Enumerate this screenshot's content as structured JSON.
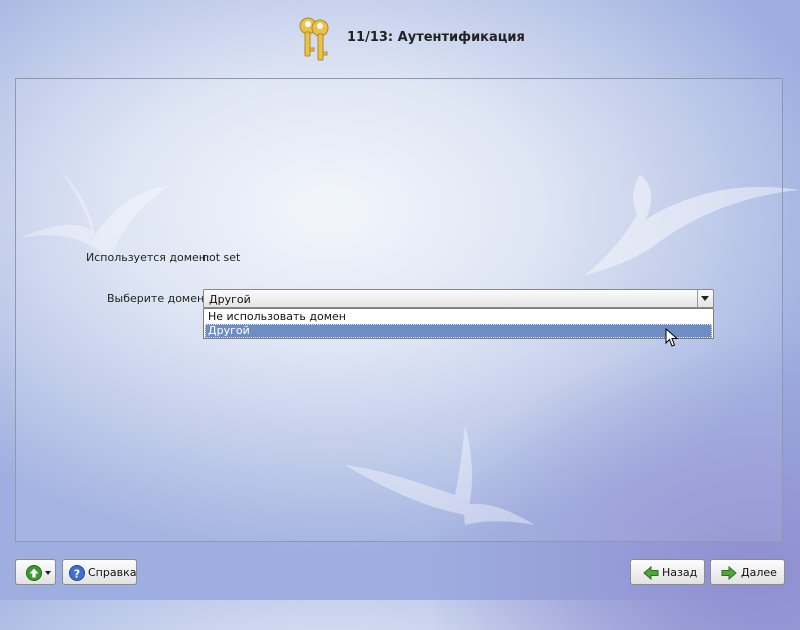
{
  "header": {
    "title": "11/13: Аутентификация",
    "icon": "keys-icon"
  },
  "form": {
    "domain_in_use_label": "Используется домен:",
    "domain_in_use_value": "not set",
    "choose_domain_label": "Выберите домен:",
    "choose_domain_value": "Другой",
    "options": [
      "Не использовать домен",
      "Другой"
    ],
    "highlighted_option": "Другой"
  },
  "buttons": {
    "menu_icon": "green-up-arrow-icon",
    "help_label": "Справка",
    "back_label": "Назад",
    "next_label": "Далее"
  },
  "colors": {
    "selection": "#6f8dc5",
    "arrow_green": "#3c9a2c"
  }
}
